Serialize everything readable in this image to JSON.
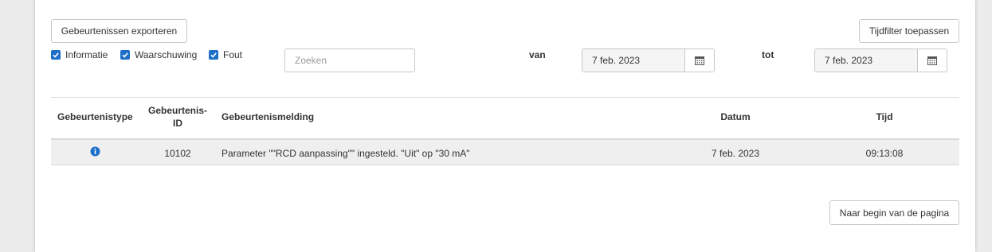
{
  "toolbar": {
    "export_label": "Gebeurtenissen exporteren",
    "apply_filter_label": "Tijdfilter toepassen"
  },
  "filters": {
    "checkboxes": [
      {
        "label": "Informatie",
        "checked": true
      },
      {
        "label": "Waarschuwing",
        "checked": true
      },
      {
        "label": "Fout",
        "checked": true
      }
    ],
    "search_placeholder": "Zoeken",
    "from_label": "van",
    "from_date": "7 feb. 2023",
    "to_label": "tot",
    "to_date": "7 feb. 2023",
    "calendar_icon": "calendar-icon"
  },
  "table": {
    "headers": {
      "type": "Gebeurtenistype",
      "id_line1": "Gebeurtenis-",
      "id_line2": "ID",
      "message": "Gebeurtenismelding",
      "date": "Datum",
      "time": "Tijd"
    },
    "rows": [
      {
        "type_icon": "info-icon",
        "id": "10102",
        "message": "Parameter \"\"RCD aanpassing\"\" ingesteld. \"Uit\" op \"30 mA\"",
        "date": "7 feb. 2023",
        "time": "09:13:08"
      }
    ]
  },
  "footer": {
    "back_to_top_label": "Naar begin van de pagina"
  },
  "colors": {
    "accent": "#1e6fc8",
    "row_bg": "#efefef"
  }
}
